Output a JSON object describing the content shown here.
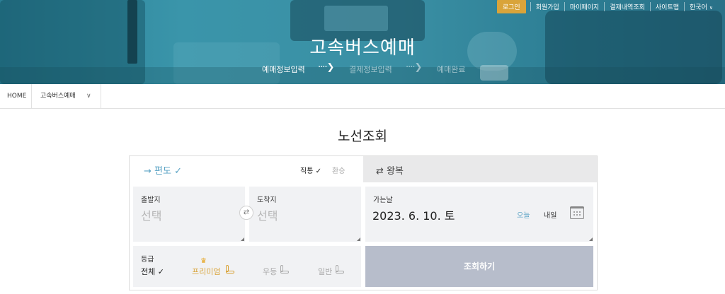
{
  "header": {
    "title": "고속버스예매",
    "steps": [
      {
        "label": "예매정보입력",
        "active": true
      },
      {
        "label": "결제정보입력",
        "active": false
      },
      {
        "label": "예매완료",
        "active": false
      }
    ]
  },
  "util_nav": {
    "login": "로그인",
    "links": [
      "회원가입",
      "마이페이지",
      "결제내역조회",
      "사이트맵"
    ],
    "language": "한국어"
  },
  "breadcrumb": {
    "home": "HOME",
    "current": "고속버스예매"
  },
  "page_title": "노선조회",
  "trip_type": {
    "oneway": "→ 편도 ✓",
    "direct": "직통 ✓",
    "transfer": "환승",
    "roundtrip": "⇄ 왕복"
  },
  "departure": {
    "label": "출발지",
    "value": "선택"
  },
  "arrival": {
    "label": "도착지",
    "value": "선택"
  },
  "date": {
    "label": "가는날",
    "value": "2023. 6. 10. 토",
    "today": "오늘",
    "tomorrow": "내일"
  },
  "grade": {
    "label": "등급",
    "options": [
      "전체 ✓",
      "프리미엄",
      "우등",
      "일반"
    ]
  },
  "search_button": "조회하기",
  "colors": {
    "accent": "#5aa3c4",
    "premium": "#d9a43a",
    "button": "#b7bdcb"
  }
}
